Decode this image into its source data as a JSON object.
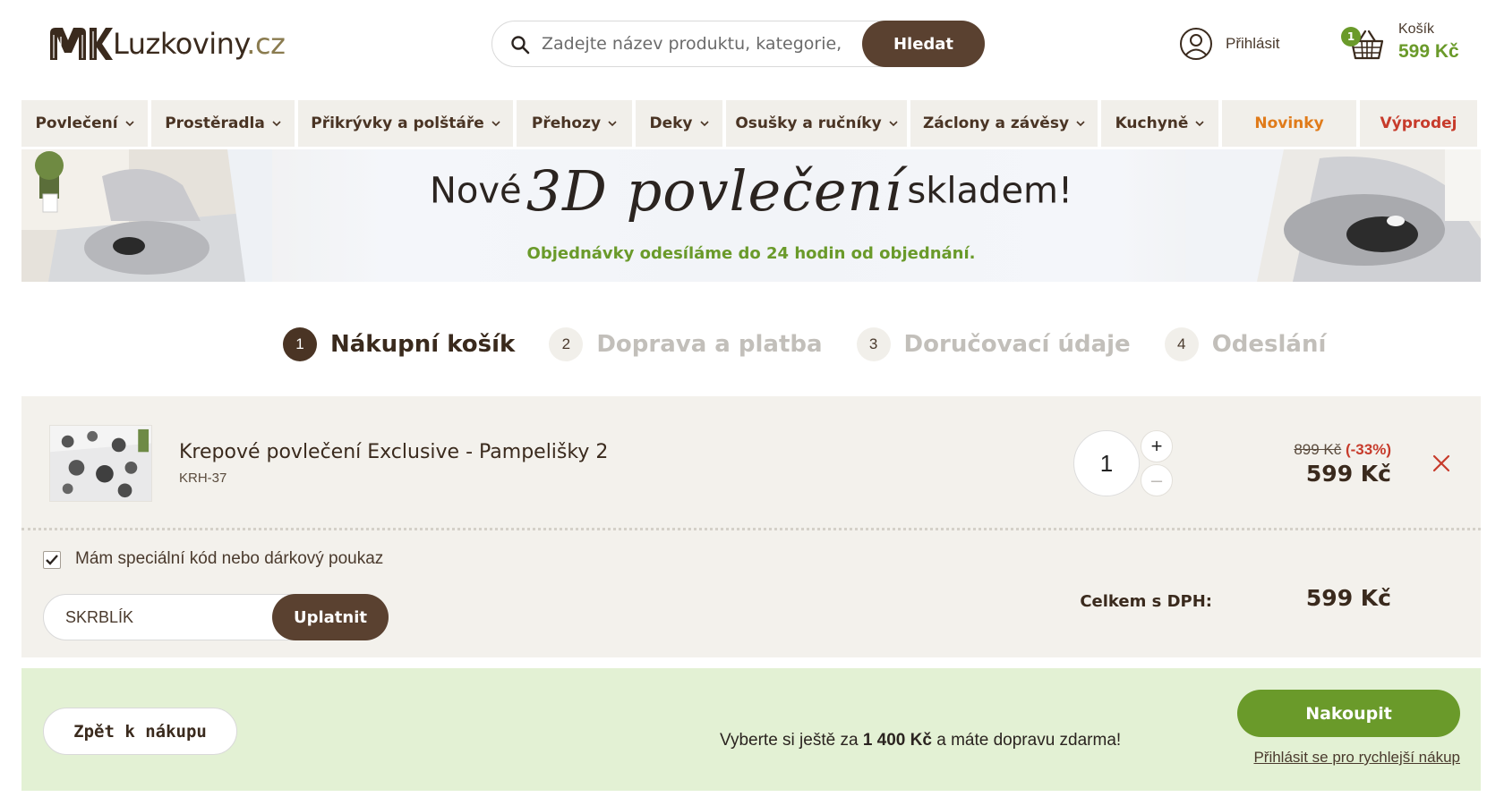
{
  "header": {
    "logo_text": "Luzkoviny",
    "logo_tld": ".cz",
    "search_placeholder": "Zadejte název produktu, kategorie, ...",
    "search_button": "Hledat",
    "login_label": "Přihlásit",
    "cart_label": "Košík",
    "cart_count": "1",
    "cart_total": "599 Kč"
  },
  "nav": {
    "items": [
      {
        "label": "Povlečení"
      },
      {
        "label": "Prostěradla"
      },
      {
        "label": "Přikrývky a polštáře"
      },
      {
        "label": "Přehozy"
      },
      {
        "label": "Deky"
      },
      {
        "label": "Osušky a ručníky"
      },
      {
        "label": "Záclony a závěsy"
      },
      {
        "label": "Kuchyně"
      }
    ],
    "novinky": "Novinky",
    "vyprodej": "Výprodej",
    "colors": {
      "novinky": "#e07b1a",
      "vyprodej": "#c73b2b"
    }
  },
  "banner": {
    "title_part1": "Nové",
    "title_part2": "3D povlečení",
    "title_part3": "skladem!",
    "subtitle": "Objednávky odesíláme do 24 hodin od objednání."
  },
  "steps": [
    {
      "num": "1",
      "label": "Nákupní košík"
    },
    {
      "num": "2",
      "label": "Doprava a platba"
    },
    {
      "num": "3",
      "label": "Doručovací údaje"
    },
    {
      "num": "4",
      "label": "Odeslání"
    }
  ],
  "cart": {
    "product": {
      "name": "Krepové povlečení Exclusive - Pampelišky 2",
      "code": "KRH-37",
      "quantity": "1",
      "qty_plus": "+",
      "qty_minus": "–",
      "price_old": "899 Kč",
      "discount": "(-33%)",
      "price_new": "599 Kč"
    },
    "coupon_label": "Mám speciální kód nebo dárkový poukaz",
    "coupon_checked": true,
    "coupon_value": "SKRBLÍK",
    "coupon_button": "Uplatnit",
    "total_label": "Celkem s DPH:",
    "total_value": "599 Kč"
  },
  "bottom": {
    "back_button": "Zpět k nákupu",
    "free_ship_prefix": "Vyberte si ještě za",
    "free_ship_amount": "1 400 Kč",
    "free_ship_suffix": "a máte dopravu zdarma!",
    "buy_button": "Nakoupit",
    "fast_login_link": "Přihlásit se pro rychlejší nákup"
  },
  "colors": {
    "brown": "#5a4130",
    "green": "#6a9a2a",
    "light_green_bg": "#e3f1d4",
    "beige_bg": "#f3f1ec"
  }
}
